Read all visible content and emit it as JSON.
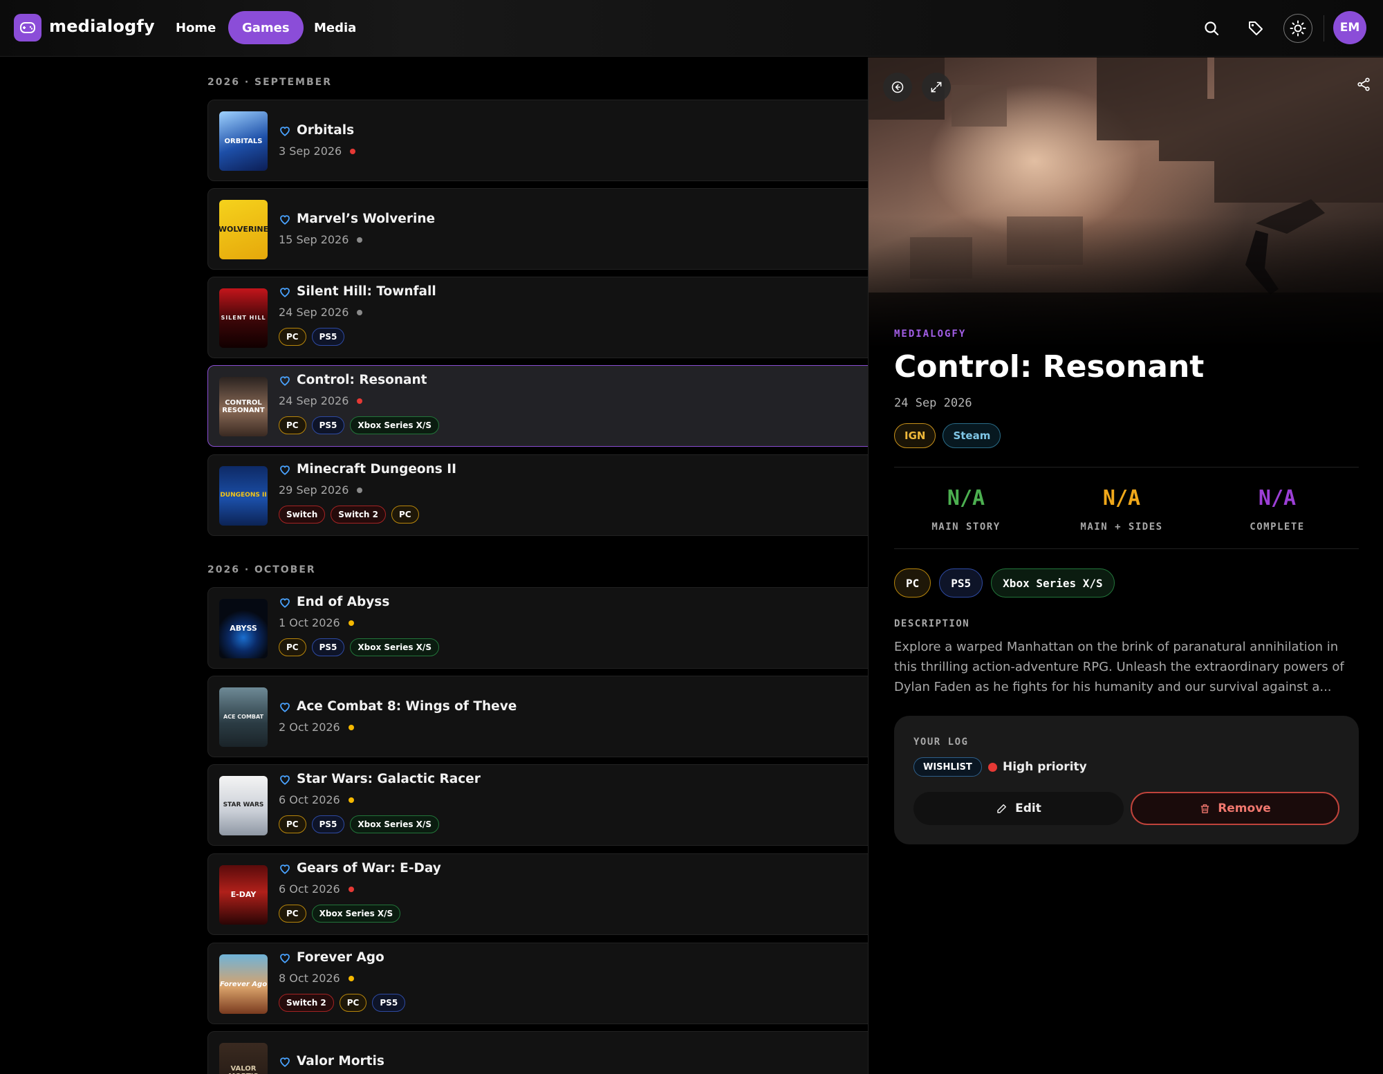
{
  "app": {
    "name": "medialogfy"
  },
  "nav": {
    "home": "Home",
    "games": "Games",
    "media": "Media"
  },
  "user": {
    "initials": "EM"
  },
  "sections": [
    {
      "label": "2026 · SEPTEMBER"
    },
    {
      "label": "2026 · OCTOBER"
    }
  ],
  "games": [
    {
      "title": "Orbitals",
      "date": "3 Sep 2026",
      "priority": "high",
      "platforms": []
    },
    {
      "title": "Marvel’s Wolverine",
      "date": "15 Sep 2026",
      "priority": "none",
      "platforms": []
    },
    {
      "title": "Silent Hill: Townfall",
      "date": "24 Sep 2026",
      "priority": "none",
      "platforms": [
        "PC",
        "PS5"
      ]
    },
    {
      "title": "Control: Resonant",
      "date": "24 Sep 2026",
      "priority": "high",
      "platforms": [
        "PC",
        "PS5",
        "Xbox Series X/S"
      ]
    },
    {
      "title": "Minecraft Dungeons II",
      "date": "29 Sep 2026",
      "priority": "none",
      "platforms": [
        "Switch",
        "Switch 2",
        "PC"
      ]
    },
    {
      "title": "End of Abyss",
      "date": "1 Oct 2026",
      "priority": "medium",
      "platforms": [
        "PC",
        "PS5",
        "Xbox Series X/S"
      ]
    },
    {
      "title": "Ace Combat 8: Wings of Theve",
      "date": "2 Oct 2026",
      "priority": "medium",
      "platforms": []
    },
    {
      "title": "Star Wars: Galactic Racer",
      "date": "6 Oct 2026",
      "priority": "medium",
      "platforms": [
        "PC",
        "PS5",
        "Xbox Series X/S"
      ]
    },
    {
      "title": "Gears of War: E-Day",
      "date": "6 Oct 2026",
      "priority": "high",
      "platforms": [
        "PC",
        "Xbox Series X/S"
      ]
    },
    {
      "title": "Forever Ago",
      "date": "8 Oct 2026",
      "priority": "medium",
      "platforms": [
        "Switch 2",
        "PC",
        "PS5"
      ]
    },
    {
      "title": "Valor Mortis",
      "date": "",
      "priority": "none",
      "platforms": []
    }
  ],
  "covers": {
    "orbitals": "ORBITALS",
    "wolverine": "WOLVERINE",
    "silent_hill": "SILENT HILL",
    "control": "CONTROL RESONANT",
    "minecraft": "DUNGEONS II",
    "abyss": "ABYSS",
    "ace_combat": "ACE COMBAT",
    "star_wars": "STAR WARS",
    "gears": "E-DAY",
    "forever": "Forever Ago",
    "valor": "VALOR MORTIS"
  },
  "detail": {
    "eyebrow": "MEDIALOGFY",
    "title": "Control: Resonant",
    "date": "24 Sep 2026",
    "links": [
      "IGN",
      "Steam"
    ],
    "stats": [
      {
        "value": "N/A",
        "label": "MAIN STORY",
        "color": "#4caf50"
      },
      {
        "value": "N/A",
        "label": "MAIN + SIDES",
        "color": "#f0a81a"
      },
      {
        "value": "N/A",
        "label": "COMPLETE",
        "color": "#9c3fd6"
      }
    ],
    "platforms": [
      "PC",
      "PS5",
      "Xbox Series X/S"
    ],
    "description_label": "DESCRIPTION",
    "description": "Explore a warped Manhattan on the brink of paranatural annihilation in this thrilling action-adventure RPG. Unleash the extraordinary powers of Dylan Faden as he fights for his humanity and our survival against a...",
    "log": {
      "label": "YOUR LOG",
      "status": "WISHLIST",
      "priority": "High priority",
      "edit": "Edit",
      "remove": "Remove"
    }
  },
  "colors": {
    "accent": "#8b4dd8",
    "priority_high": "#e53935",
    "priority_medium": "#f5b800",
    "priority_none": "#8a8a8a",
    "heart": "#4aa3ff"
  }
}
